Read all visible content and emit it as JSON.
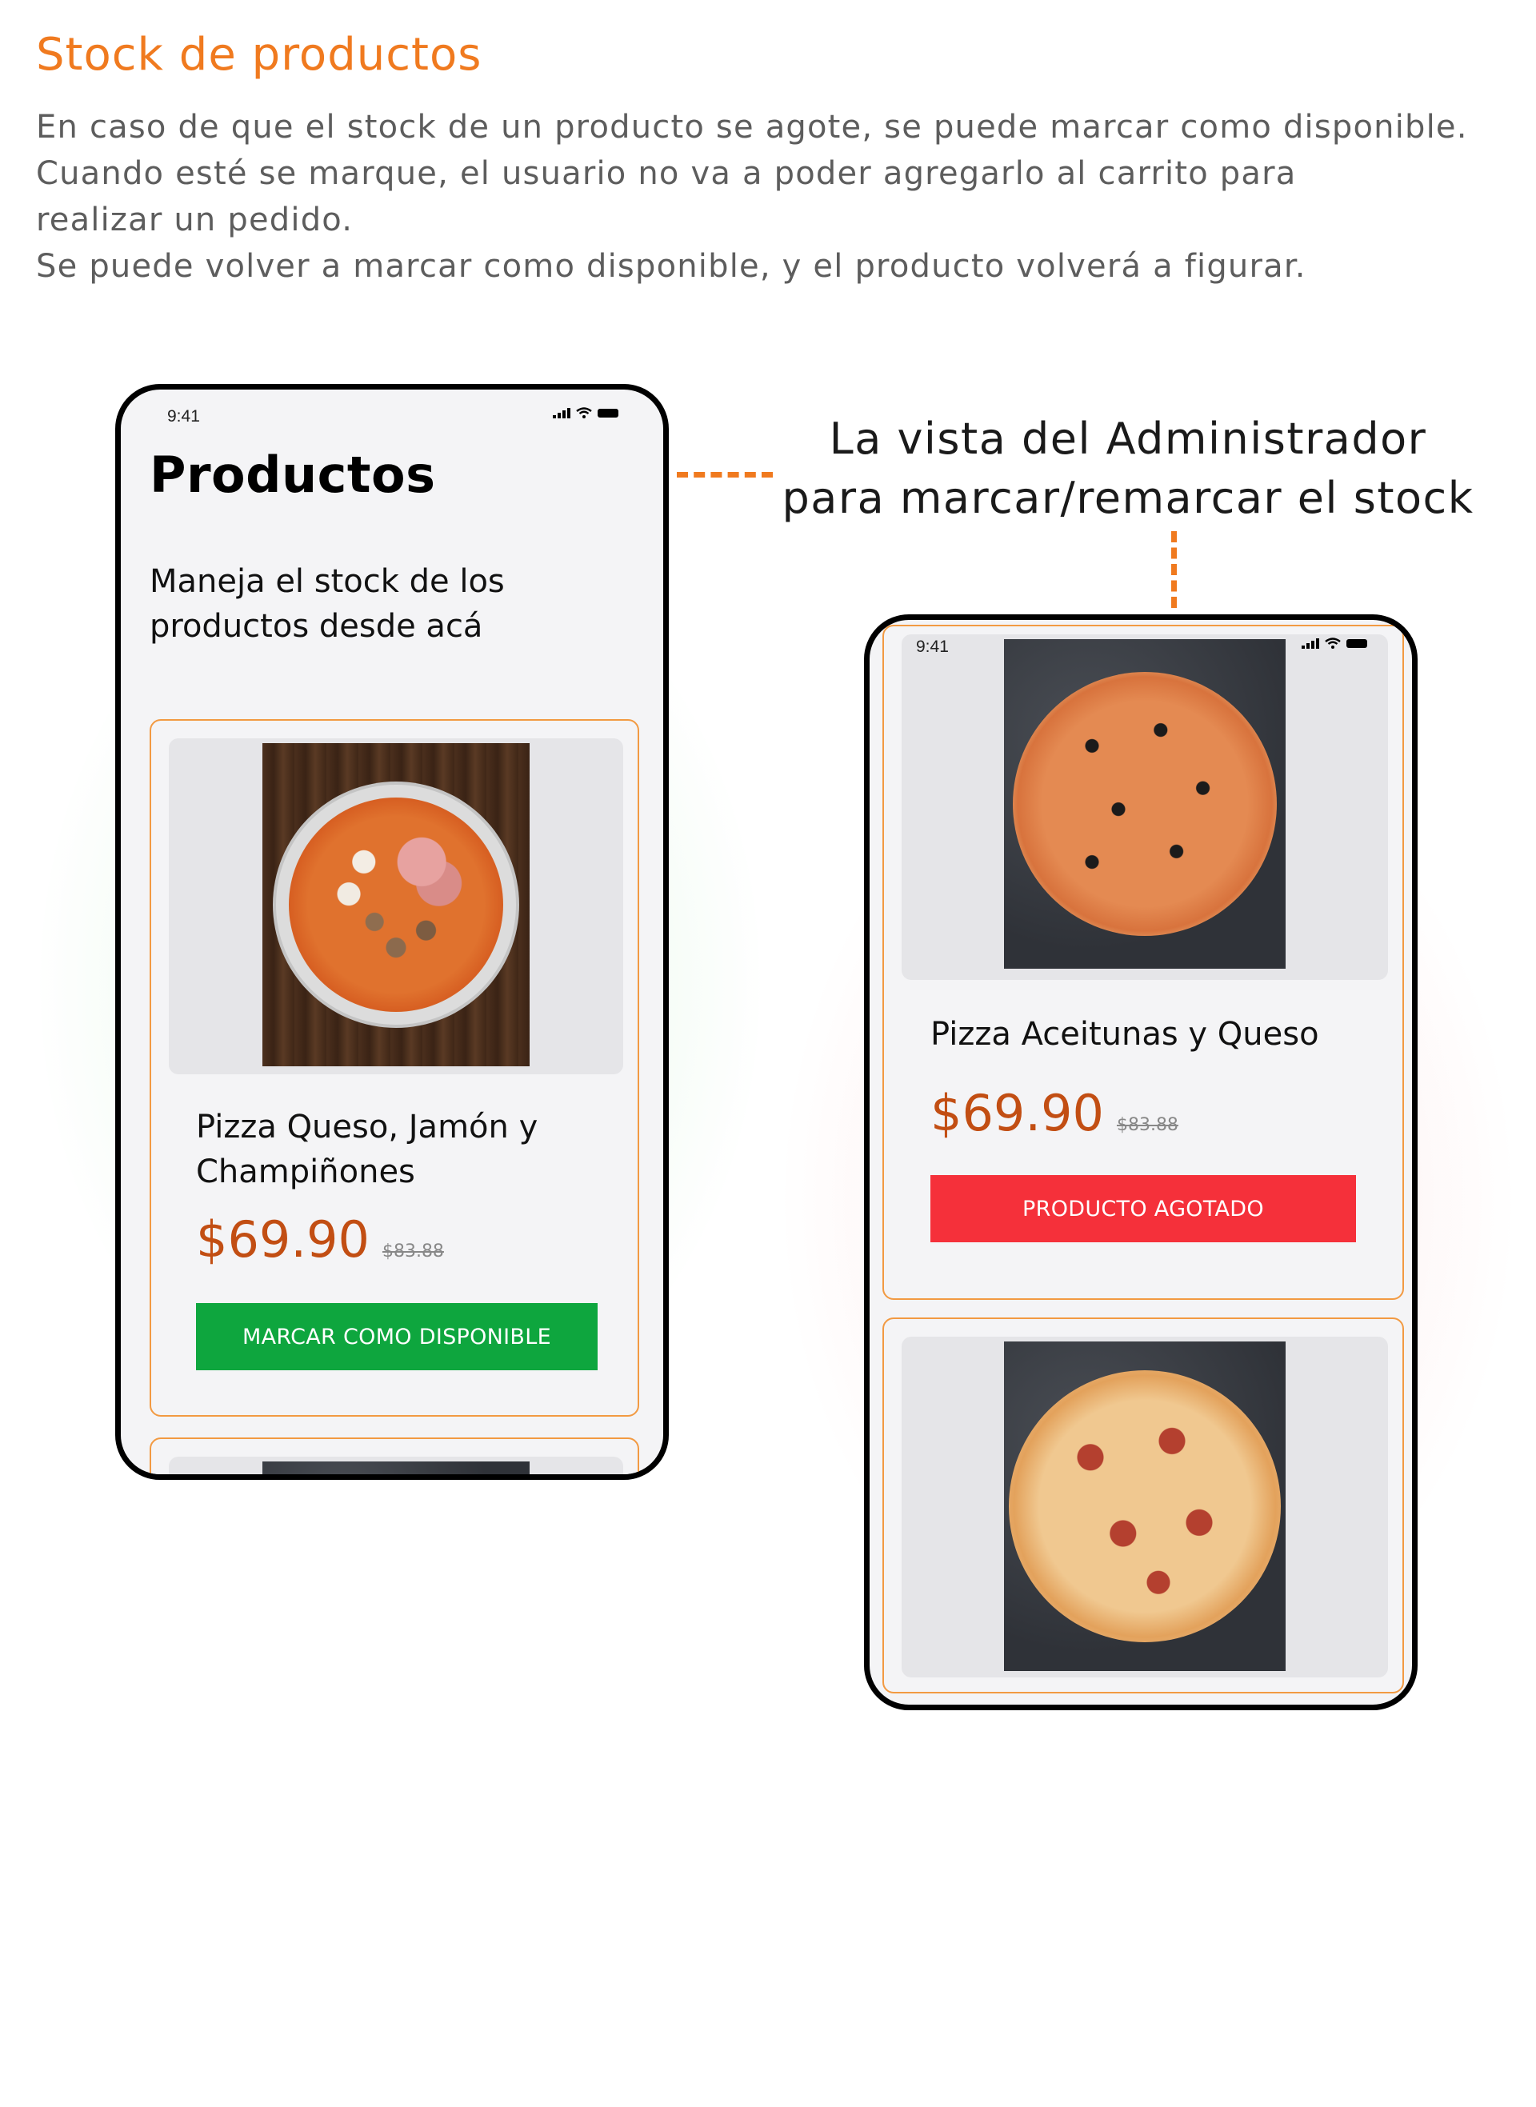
{
  "page": {
    "title": "Stock de productos",
    "description": [
      "En caso de que el stock de un producto se agote, se puede marcar como disponible.",
      "Cuando esté se marque, el usuario no va a poder agregarlo al carrito para",
      "realizar un pedido.",
      "Se puede volver a marcar como disponible, y el producto volverá a figurar."
    ],
    "callout": [
      "La vista del Administrador",
      "para marcar/remarcar el stock"
    ]
  },
  "colors": {
    "accent": "#f07a1f",
    "price": "#c24e13",
    "available_button": "#0ea63e",
    "sold_out_button": "#f5303a",
    "card_border": "#f29a42"
  },
  "left_phone": {
    "status_time": "9:41",
    "heading": "Productos",
    "subtitle": "Maneja el stock de los productos desde acá",
    "product": {
      "name": "Pizza Queso, Jamón y Champiñones",
      "price": "$69.90",
      "old_price": "$83.88",
      "button_label": "MARCAR COMO DISPONIBLE"
    }
  },
  "right_phone": {
    "status_time": "9:41",
    "product": {
      "name": "Pizza Aceitunas y Queso",
      "price": "$69.90",
      "old_price": "$83.88",
      "button_label": "PRODUCTO AGOTADO"
    }
  },
  "icons": [
    "signal-icon",
    "wifi-icon",
    "battery-icon"
  ]
}
